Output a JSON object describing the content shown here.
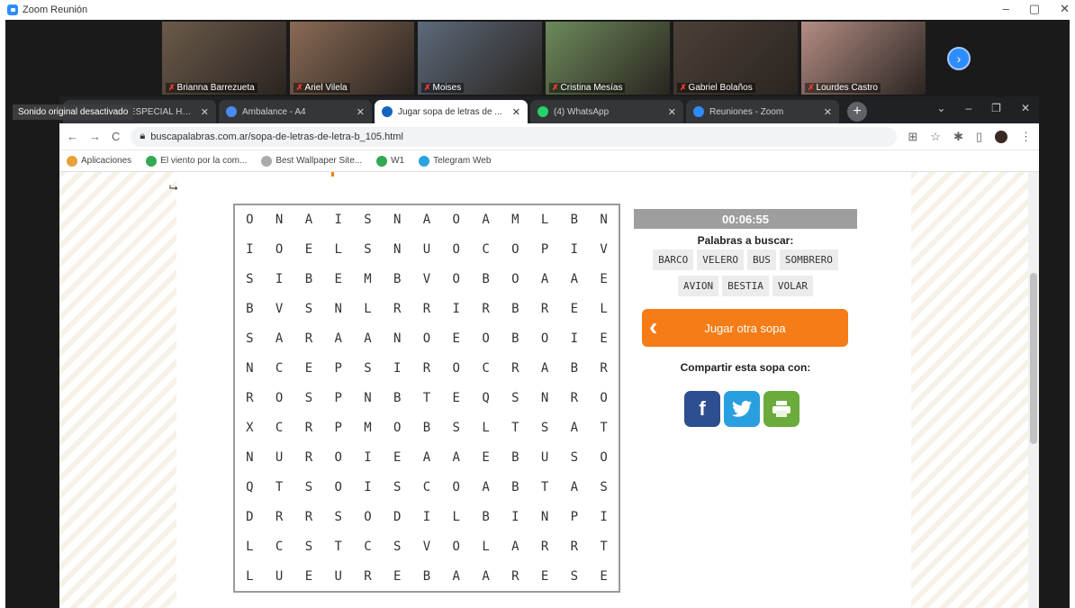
{
  "zoom": {
    "title": "Zoom Reunión",
    "win_min": "–",
    "win_max": "▢",
    "win_close": "✕"
  },
  "participants": [
    {
      "name": "Brianna Barrezueta",
      "bg": "#6b5a4a"
    },
    {
      "name": "Ariel Vilela",
      "bg": "#8a6a55"
    },
    {
      "name": "Moises",
      "bg": "#5c6a7a"
    },
    {
      "name": "Cristina Mesías",
      "bg": "#6c8a5a"
    },
    {
      "name": "Gabriel Bolaños",
      "bg": "#4b4036"
    },
    {
      "name": "Lourdes Castro",
      "bg": "#b38d84"
    }
  ],
  "tooltip": "Sonido original desactivado",
  "browser": {
    "tabs": [
      {
        "title": "(1) ZOOM ESPECIAL HUA...",
        "color": "#2d8cff",
        "active": false
      },
      {
        "title": "Ambalance - A4",
        "color": "#4a8af4",
        "active": false
      },
      {
        "title": "Jugar sopa de letras de ...",
        "color": "#1565c0",
        "active": true
      },
      {
        "title": "(4) WhatsApp",
        "color": "#25d366",
        "active": false
      },
      {
        "title": "Reuniones - Zoom",
        "color": "#2d8cff",
        "active": false
      }
    ],
    "url": "buscapalabras.com.ar/sopa-de-letras-de-letra-b_105.html",
    "bookmarks": [
      {
        "label": "Aplicaciones",
        "color": "#e8a23c"
      },
      {
        "label": "El viento por la com...",
        "color": "#34a853"
      },
      {
        "label": "Best Wallpaper Site...",
        "color": "#aaaaaa"
      },
      {
        "label": "W1",
        "color": "#34a853"
      },
      {
        "label": "Telegram Web",
        "color": "#2aa3df"
      }
    ]
  },
  "game": {
    "timer": "00:06:55",
    "words_title": "Palabras a buscar:",
    "words": [
      "BARCO",
      "VELERO",
      "BUS",
      "SOMBRERO",
      "AVION",
      "BESTIA",
      "VOLAR"
    ],
    "play_again": "Jugar otra sopa",
    "share_title": "Compartir esta sopa con:",
    "grid": [
      [
        "O",
        "N",
        "A",
        "I",
        "S",
        "N",
        "A",
        "O",
        "A",
        "M",
        "L",
        "B",
        "N"
      ],
      [
        "I",
        "O",
        "E",
        "L",
        "S",
        "N",
        "U",
        "O",
        "C",
        "O",
        "P",
        "I",
        "V"
      ],
      [
        "S",
        "I",
        "B",
        "E",
        "M",
        "B",
        "V",
        "O",
        "B",
        "O",
        "A",
        "A",
        "E"
      ],
      [
        "B",
        "V",
        "S",
        "N",
        "L",
        "R",
        "R",
        "I",
        "R",
        "B",
        "R",
        "E",
        "L"
      ],
      [
        "S",
        "A",
        "R",
        "A",
        "A",
        "N",
        "O",
        "E",
        "O",
        "B",
        "O",
        "I",
        "E"
      ],
      [
        "N",
        "C",
        "E",
        "P",
        "S",
        "I",
        "R",
        "O",
        "C",
        "R",
        "A",
        "B",
        "R"
      ],
      [
        "R",
        "O",
        "S",
        "P",
        "N",
        "B",
        "T",
        "E",
        "Q",
        "S",
        "N",
        "R",
        "O"
      ],
      [
        "X",
        "C",
        "R",
        "P",
        "M",
        "O",
        "B",
        "S",
        "L",
        "T",
        "S",
        "A",
        "T"
      ],
      [
        "N",
        "U",
        "R",
        "O",
        "I",
        "E",
        "A",
        "A",
        "E",
        "B",
        "U",
        "S",
        "O"
      ],
      [
        "Q",
        "T",
        "S",
        "O",
        "I",
        "S",
        "C",
        "O",
        "A",
        "B",
        "T",
        "A",
        "S"
      ],
      [
        "D",
        "R",
        "R",
        "S",
        "O",
        "D",
        "I",
        "L",
        "B",
        "I",
        "N",
        "P",
        "I"
      ],
      [
        "L",
        "C",
        "S",
        "T",
        "C",
        "S",
        "V",
        "O",
        "L",
        "A",
        "R",
        "R",
        "T"
      ],
      [
        "L",
        "U",
        "E",
        "U",
        "R",
        "E",
        "B",
        "A",
        "A",
        "R",
        "E",
        "S",
        "E"
      ]
    ]
  }
}
